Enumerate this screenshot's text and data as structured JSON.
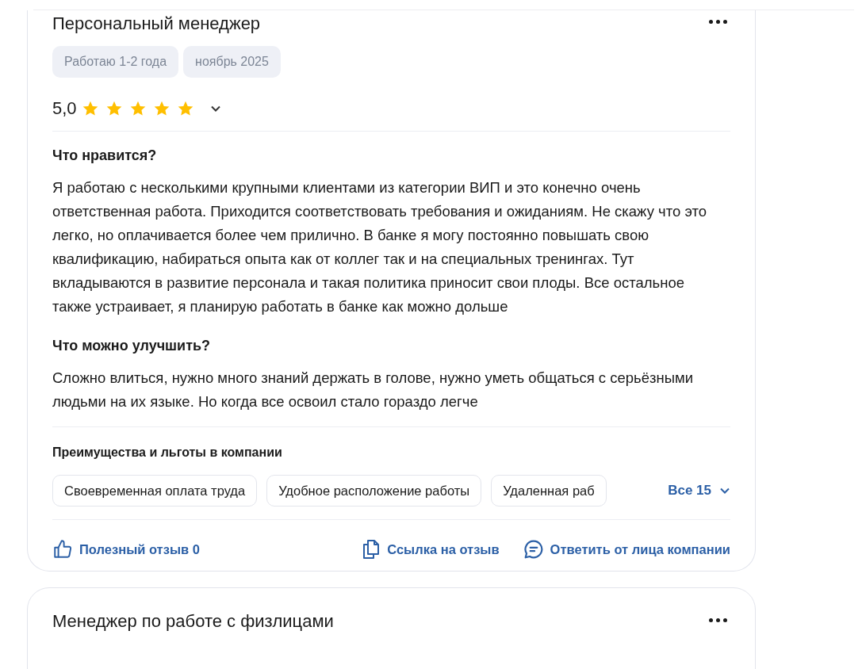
{
  "review": {
    "title": "Персональный менеджер",
    "tags": [
      "Работаю 1-2 года",
      "ноябрь 2025"
    ],
    "rating": "5,0",
    "stars": 5,
    "sections": [
      {
        "heading": "Что нравится?",
        "text": "Я работаю с несколькими крупными клиентами из категории ВИП и это конечно очень ответственная работа. Приходится соответствовать требования и ожиданиям. Не скажу что это легко, но оплачивается более чем прилично. В банке я могу постоянно повышать свою квалификацию, набираться опыта как от коллег так и на специальных тренингах. Тут вкладываются в развитие персонала и такая политика приносит свои плоды. Все остальное также устраивает, я планирую работать в банке как можно дольше"
      },
      {
        "heading": "Что можно улучшить?",
        "text": "Сложно влиться, нужно много знаний держать в голове, нужно уметь общаться с серьёзными людьми на их языке. Но когда все освоил стало гораздо легче"
      }
    ],
    "benefits_heading": "Преимущества и льготы в компании",
    "benefits": [
      "Своевременная оплата труда",
      "Удобное расположение работы",
      "Удаленная раб"
    ],
    "benefits_more": "Все 15",
    "actions": [
      {
        "kind": "like",
        "label": "Полезный отзыв 0"
      },
      {
        "kind": "link",
        "label": "Ссылка на отзыв"
      },
      {
        "kind": "reply",
        "label": "Ответить от лица компании"
      }
    ]
  },
  "next_review": {
    "title": "Менеджер по работе с физлицами"
  }
}
